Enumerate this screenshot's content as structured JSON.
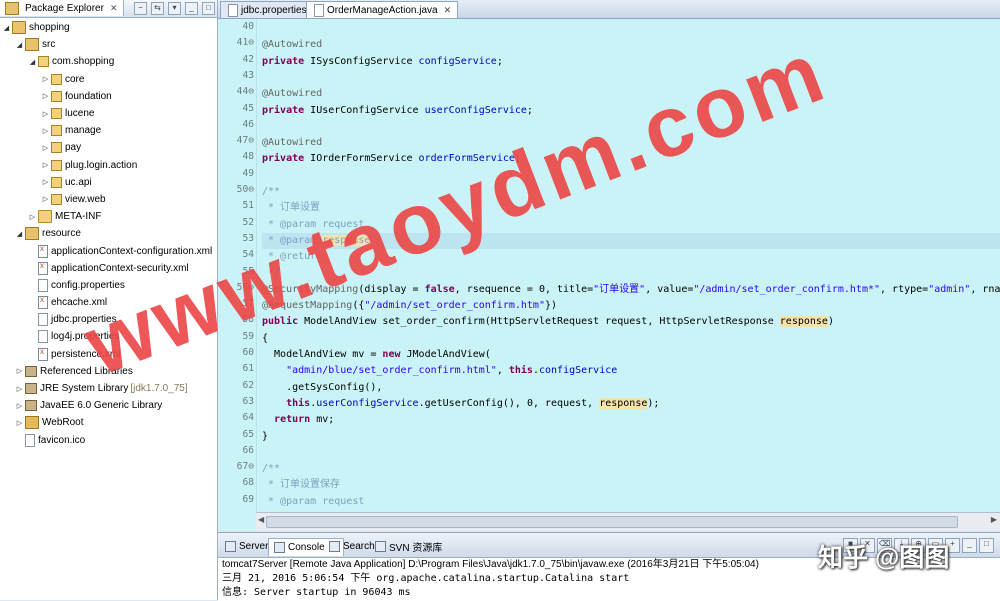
{
  "package_explorer": {
    "tab_label": "Package Explorer",
    "close_glyph": "✕",
    "tree": [
      {
        "label": "shopping",
        "level": 0,
        "icon": "project-icon",
        "expanded": true,
        "note": ""
      },
      {
        "label": "src",
        "level": 1,
        "icon": "source-folder-icon",
        "expanded": true,
        "note": ""
      },
      {
        "label": "com.shopping",
        "level": 2,
        "icon": "package-icon",
        "expanded": true,
        "note": ""
      },
      {
        "label": "core",
        "level": 3,
        "icon": "package-icon",
        "expanded": false,
        "note": ""
      },
      {
        "label": "foundation",
        "level": 3,
        "icon": "package-icon",
        "expanded": false,
        "note": ""
      },
      {
        "label": "lucene",
        "level": 3,
        "icon": "package-icon",
        "expanded": false,
        "note": ""
      },
      {
        "label": "manage",
        "level": 3,
        "icon": "package-icon",
        "expanded": false,
        "note": ""
      },
      {
        "label": "pay",
        "level": 3,
        "icon": "package-icon",
        "expanded": false,
        "note": ""
      },
      {
        "label": "plug.login.action",
        "level": 3,
        "icon": "package-icon",
        "expanded": false,
        "note": ""
      },
      {
        "label": "uc.api",
        "level": 3,
        "icon": "package-icon",
        "expanded": false,
        "note": ""
      },
      {
        "label": "view.web",
        "level": 3,
        "icon": "package-icon",
        "expanded": false,
        "note": ""
      },
      {
        "label": "META-INF",
        "level": 2,
        "icon": "folder-icon",
        "expanded": false,
        "note": ""
      },
      {
        "label": "resource",
        "level": 1,
        "icon": "source-folder-icon",
        "expanded": true,
        "note": ""
      },
      {
        "label": "applicationContext-configuration.xml",
        "level": 2,
        "icon": "xml-file-icon",
        "expanded": null,
        "note": ""
      },
      {
        "label": "applicationContext-security.xml",
        "level": 2,
        "icon": "xml-file-icon",
        "expanded": null,
        "note": ""
      },
      {
        "label": "config.properties",
        "level": 2,
        "icon": "file-icon",
        "expanded": null,
        "note": ""
      },
      {
        "label": "ehcache.xml",
        "level": 2,
        "icon": "xml-file-icon",
        "expanded": null,
        "note": ""
      },
      {
        "label": "jdbc.properties",
        "level": 2,
        "icon": "file-icon",
        "expanded": null,
        "note": ""
      },
      {
        "label": "log4j.properties",
        "level": 2,
        "icon": "file-icon",
        "expanded": null,
        "note": ""
      },
      {
        "label": "persistence.xml",
        "level": 2,
        "icon": "xml-file-icon",
        "expanded": null,
        "note": ""
      },
      {
        "label": "Referenced Libraries",
        "level": 1,
        "icon": "library-icon",
        "expanded": false,
        "note": ""
      },
      {
        "label": "JRE System Library",
        "level": 1,
        "icon": "library-icon",
        "expanded": false,
        "note": "[jdk1.7.0_75]"
      },
      {
        "label": "JavaEE 6.0 Generic Library",
        "level": 1,
        "icon": "library-icon",
        "expanded": false,
        "note": ""
      },
      {
        "label": "WebRoot",
        "level": 1,
        "icon": "web-folder-icon",
        "expanded": false,
        "note": ""
      },
      {
        "label": "favicon.ico",
        "level": 1,
        "icon": "file-icon",
        "expanded": null,
        "note": ""
      }
    ]
  },
  "editor": {
    "tabs": [
      {
        "label": "jdbc.properties",
        "active": false
      },
      {
        "label": "OrderManageAction.java",
        "active": true
      }
    ],
    "close_glyph": "✕",
    "first_line": 40,
    "highlight_line": 53,
    "fold_lines": [
      41,
      44,
      47,
      50,
      56,
      67
    ],
    "lines": [
      [],
      [
        {
          "t": "@Autowired",
          "c": "an"
        }
      ],
      [
        {
          "t": "private ",
          "c": "kw"
        },
        {
          "t": "ISysConfigService ",
          "c": ""
        },
        {
          "t": "configService",
          "c": "fld"
        },
        {
          "t": ";",
          "c": ""
        }
      ],
      [],
      [
        {
          "t": "@Autowired",
          "c": "an"
        }
      ],
      [
        {
          "t": "private ",
          "c": "kw"
        },
        {
          "t": "IUserConfigService ",
          "c": ""
        },
        {
          "t": "userConfigService",
          "c": "fld"
        },
        {
          "t": ";",
          "c": ""
        }
      ],
      [],
      [
        {
          "t": "@Autowired",
          "c": "an"
        }
      ],
      [
        {
          "t": "private ",
          "c": "kw"
        },
        {
          "t": "IOrderFormService ",
          "c": ""
        },
        {
          "t": "orderFormService",
          "c": "fld"
        },
        {
          "t": ";",
          "c": ""
        }
      ],
      [],
      [
        {
          "t": "/**",
          "c": "jd"
        }
      ],
      [
        {
          "t": " * 订单设置",
          "c": "jd"
        }
      ],
      [
        {
          "t": " * @param ",
          "c": "jd"
        },
        {
          "t": "request",
          "c": "jd"
        }
      ],
      [
        {
          "t": " * @param ",
          "c": "jd"
        },
        {
          "t": "response",
          "c": "jd occ"
        }
      ],
      [
        {
          "t": " * @return",
          "c": "jd"
        }
      ],
      [
        {
          "t": " */",
          "c": "jd"
        }
      ],
      [
        {
          "t": "@SecurityMapping",
          "c": "an"
        },
        {
          "t": "(display = ",
          "c": ""
        },
        {
          "t": "false",
          "c": "kw"
        },
        {
          "t": ", rsequence = 0, title=",
          "c": ""
        },
        {
          "t": "\"订单设置\"",
          "c": "str"
        },
        {
          "t": ", value=",
          "c": ""
        },
        {
          "t": "\"/admin/set_order_confirm.htm*\"",
          "c": "str"
        },
        {
          "t": ", rtype=",
          "c": ""
        },
        {
          "t": "\"admin\"",
          "c": "str"
        },
        {
          "t": ", rname=",
          "c": ""
        },
        {
          "t": "\"",
          "c": "str"
        }
      ],
      [
        {
          "t": "@RequestMapping",
          "c": "an"
        },
        {
          "t": "({",
          "c": ""
        },
        {
          "t": "\"/admin/set_order_confirm.htm\"",
          "c": "str"
        },
        {
          "t": "})",
          "c": ""
        }
      ],
      [
        {
          "t": "public ",
          "c": "kw"
        },
        {
          "t": "ModelAndView set_order_confirm(HttpServletRequest request, HttpServletResponse ",
          "c": ""
        },
        {
          "t": "response",
          "c": "occ"
        },
        {
          "t": ")",
          "c": ""
        }
      ],
      [
        {
          "t": "{",
          "c": ""
        }
      ],
      [
        {
          "t": "  ModelAndView mv = ",
          "c": ""
        },
        {
          "t": "new ",
          "c": "kw"
        },
        {
          "t": "JModelAndView(",
          "c": ""
        }
      ],
      [
        {
          "t": "    ",
          "c": ""
        },
        {
          "t": "\"admin/blue/set_order_confirm.html\"",
          "c": "str"
        },
        {
          "t": ", ",
          "c": ""
        },
        {
          "t": "this",
          "c": "kw"
        },
        {
          "t": ".",
          "c": ""
        },
        {
          "t": "configService",
          "c": "fld"
        }
      ],
      [
        {
          "t": "    .getSysConfig(),",
          "c": ""
        }
      ],
      [
        {
          "t": "    ",
          "c": ""
        },
        {
          "t": "this",
          "c": "kw"
        },
        {
          "t": ".",
          "c": ""
        },
        {
          "t": "userConfigService",
          "c": "fld"
        },
        {
          "t": ".getUserConfig(), 0, request, ",
          "c": ""
        },
        {
          "t": "response",
          "c": "occ"
        },
        {
          "t": ");",
          "c": ""
        }
      ],
      [
        {
          "t": "  ",
          "c": ""
        },
        {
          "t": "return ",
          "c": "kw"
        },
        {
          "t": "mv;",
          "c": ""
        }
      ],
      [
        {
          "t": "}",
          "c": ""
        }
      ],
      [],
      [
        {
          "t": "/**",
          "c": "jd"
        }
      ],
      [
        {
          "t": " * 订单设置保存",
          "c": "jd"
        }
      ],
      [
        {
          "t": " * @param ",
          "c": "jd"
        },
        {
          "t": "request",
          "c": "jd"
        }
      ]
    ]
  },
  "console": {
    "tabs": [
      {
        "label": "Servers",
        "icon": "servers-icon",
        "active": false,
        "closable": false
      },
      {
        "label": "Console",
        "icon": "console-icon",
        "active": true,
        "closable": true
      },
      {
        "label": "Search",
        "icon": "search-icon",
        "active": false,
        "closable": false
      },
      {
        "label": "SVN 资源库",
        "icon": "svn-icon",
        "active": false,
        "closable": false
      }
    ],
    "close_glyph": "✕",
    "launch_info": "tomcat7Server [Remote Java Application] D:\\Program Files\\Java\\jdk1.7.0_75\\bin\\javaw.exe (2016年3月21日 下午5:05:04)",
    "log_lines": [
      "三月 21, 2016 5:06:54 下午 org.apache.catalina.startup.Catalina start",
      "信息: Server startup in 96043 ms"
    ]
  },
  "watermarks": {
    "main": "www.taoydm.com",
    "corner": "知乎 @图图"
  }
}
